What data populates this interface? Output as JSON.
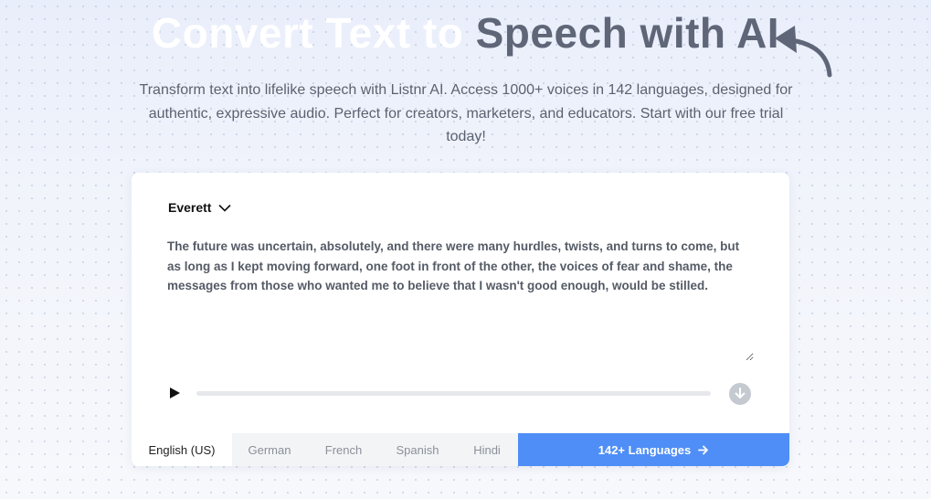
{
  "hero": {
    "title_light": "Convert Text to",
    "title_dark": "Speech with AI",
    "subtitle": "Transform text into lifelike speech with Listnr AI. Access 1000+ voices in 142 languages, designed for authentic, expressive audio. Perfect for creators, marketers, and educators. Start with our free trial today!"
  },
  "editor": {
    "voice": "Everett",
    "text": "The future was uncertain, absolutely, and there were many hurdles, twists, and turns to come, but as long as I kept moving forward, one foot in front of the other, the voices of fear and shame, the messages from those who wanted me to believe that I wasn't good enough, would be stilled.",
    "playback_progress": 0
  },
  "languages": {
    "tabs": [
      {
        "label": "English (US)",
        "active": true
      },
      {
        "label": "German",
        "active": false
      },
      {
        "label": "French",
        "active": false
      },
      {
        "label": "Spanish",
        "active": false
      },
      {
        "label": "Hindi",
        "active": false
      }
    ],
    "more_label": "142+ Languages"
  },
  "colors": {
    "accent": "#4f8ef7",
    "title_dark": "#5f6677"
  },
  "icons": [
    "curved-arrow-icon",
    "chevron-down-icon",
    "play-icon",
    "download-icon",
    "arrow-right-icon"
  ]
}
